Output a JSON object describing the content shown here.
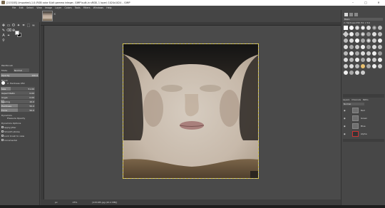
{
  "window": {
    "title": "[215185] (imported)-1.0 (RGB color 8-bit gamma integer, GIMP built-in sRGB, 1 layer) 1024x1024 – GIMP",
    "minimize": "–",
    "maximize": "□",
    "close": "✕"
  },
  "menu": [
    "File",
    "Edit",
    "Select",
    "View",
    "Image",
    "Layer",
    "Colors",
    "Tools",
    "Filters",
    "Windows",
    "Help"
  ],
  "image_tab": {
    "close": "×"
  },
  "tool_options": {
    "title": "Paintbrush",
    "mode_label": "Mode",
    "mode_value": "Normal",
    "opacity_label": "Opacity",
    "opacity_value": "100.0",
    "brush_label": "Brush",
    "brush_name": "2. Hardness 050",
    "size_label": "Size",
    "size_value": "51.00",
    "aspect_label": "Aspect Ratio",
    "aspect_value": "0.00",
    "angle_label": "Angle",
    "angle_value": "0.00",
    "spacing_label": "Spacing",
    "spacing_value": "10.0",
    "hardness_label": "Hardness",
    "hardness_value": "50.0",
    "force_label": "Force",
    "force_value": "50.0",
    "dynamics_label": "Dynamics",
    "dynamics_value": "Pressure Opacity",
    "dynamics_options": "Dynamics Options",
    "apply_jitter": "Apply Jitter",
    "smooth_stroke": "Smooth stroke",
    "lock_brush": "Lock brush to view",
    "incremental": "Incremental"
  },
  "statusbar": {
    "unit": "px",
    "zoom": "25%",
    "info": "[215185.jpg (20.2 MB)]"
  },
  "right_panel": {
    "brush_filter": "Basic,",
    "brush_name": "2. Hardness 050 (51 × 51)",
    "tabs": [
      "Layers",
      "Channels",
      "Paths"
    ],
    "mode_value": "Normal",
    "layers": [
      {
        "name": "Red"
      },
      {
        "name": "Green"
      },
      {
        "name": "Blue"
      },
      {
        "name": "Alpha"
      }
    ]
  }
}
